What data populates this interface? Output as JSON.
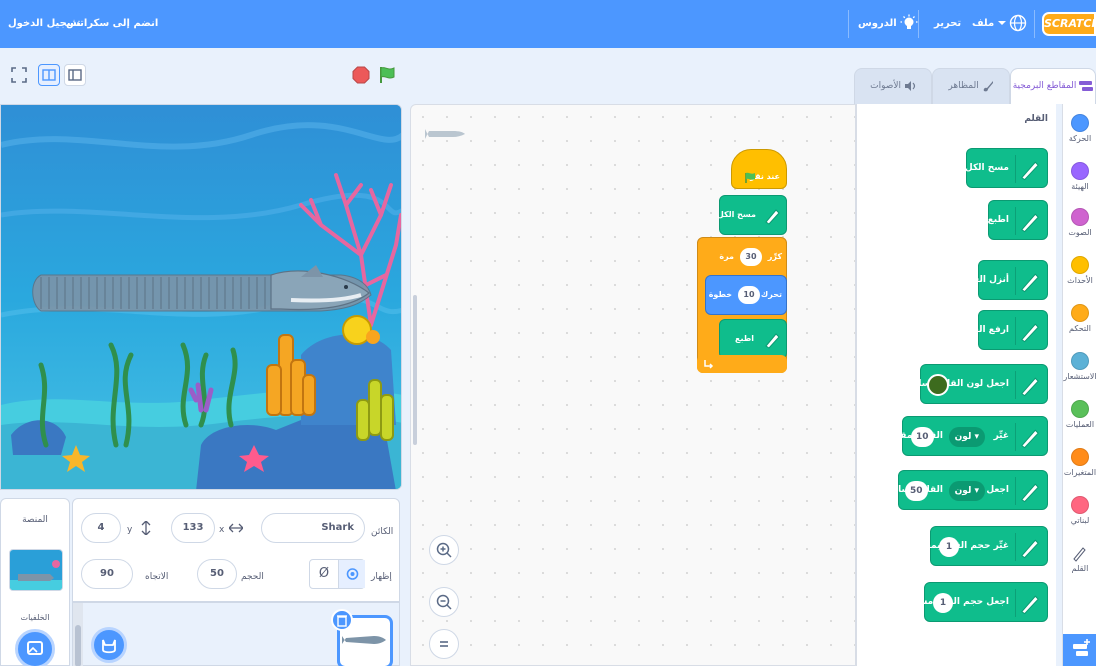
{
  "menubar": {
    "logo": "SCRATCH",
    "file": "ملف",
    "edit": "تحرير",
    "tutorials": "الدروس",
    "join": "انضم إلى سكراتش",
    "sign_in": "تسجيل الدخول"
  },
  "tabs": {
    "code": "المقاطع البرمجية",
    "costumes": "المظاهر",
    "sounds": "الأصوات"
  },
  "palette": {
    "heading": "القلم",
    "blocks": [
      {
        "label": "مسح الكل"
      },
      {
        "label": "اطبع"
      },
      {
        "label": "أنزل القلم"
      },
      {
        "label": "ارفع القلم"
      },
      {
        "label": "اجعل لون القلم مساويًا"
      },
      {
        "label": "غيِّر",
        "dropdown": "لون",
        "label2": "القلم بمقدار",
        "value": "10"
      },
      {
        "label": "اجعل",
        "dropdown": "لون",
        "label2": "القلم مساويًا",
        "value": "50"
      },
      {
        "label": "غيِّر حجم القلم بمقدار",
        "value": "1"
      },
      {
        "label": "اجعل حجم القلم مساويًا",
        "value": "1"
      }
    ]
  },
  "categories": [
    {
      "label": "الحركة",
      "color": "#4c97ff"
    },
    {
      "label": "الهيئة",
      "color": "#9966ff"
    },
    {
      "label": "الصوت",
      "color": "#cf63cf"
    },
    {
      "label": "الأحداث",
      "color": "#ffbf00"
    },
    {
      "label": "التحكم",
      "color": "#ffab19"
    },
    {
      "label": "الاستشعار",
      "color": "#5cb1d6"
    },
    {
      "label": "العمليات",
      "color": "#59c059"
    },
    {
      "label": "المتغيرات",
      "color": "#ff8c1a"
    },
    {
      "label": "لبناتي",
      "color": "#ff6680"
    },
    {
      "label": "القلم",
      "color": "#0fbd8c"
    }
  ],
  "script": {
    "hat": "عند نقر",
    "clear": "مسح الكل",
    "repeat_label": "كرِّر",
    "repeat_value": "30",
    "repeat_unit": "مرة",
    "move_label": "تحرك",
    "move_value": "10",
    "move_unit": "خطوة",
    "stamp": "اطبع"
  },
  "sprite_info": {
    "sprite_label": "الكائن",
    "sprite_name": "Shark",
    "x_label": "x",
    "x_value": "133",
    "y_label": "y",
    "y_value": "4",
    "show_label": "إظهار",
    "size_label": "الحجم",
    "size_value": "50",
    "direction_label": "الاتجاه",
    "direction_value": "90"
  },
  "stage_pane": {
    "title": "المنصة",
    "backdrops_label": "الخلفيات"
  }
}
